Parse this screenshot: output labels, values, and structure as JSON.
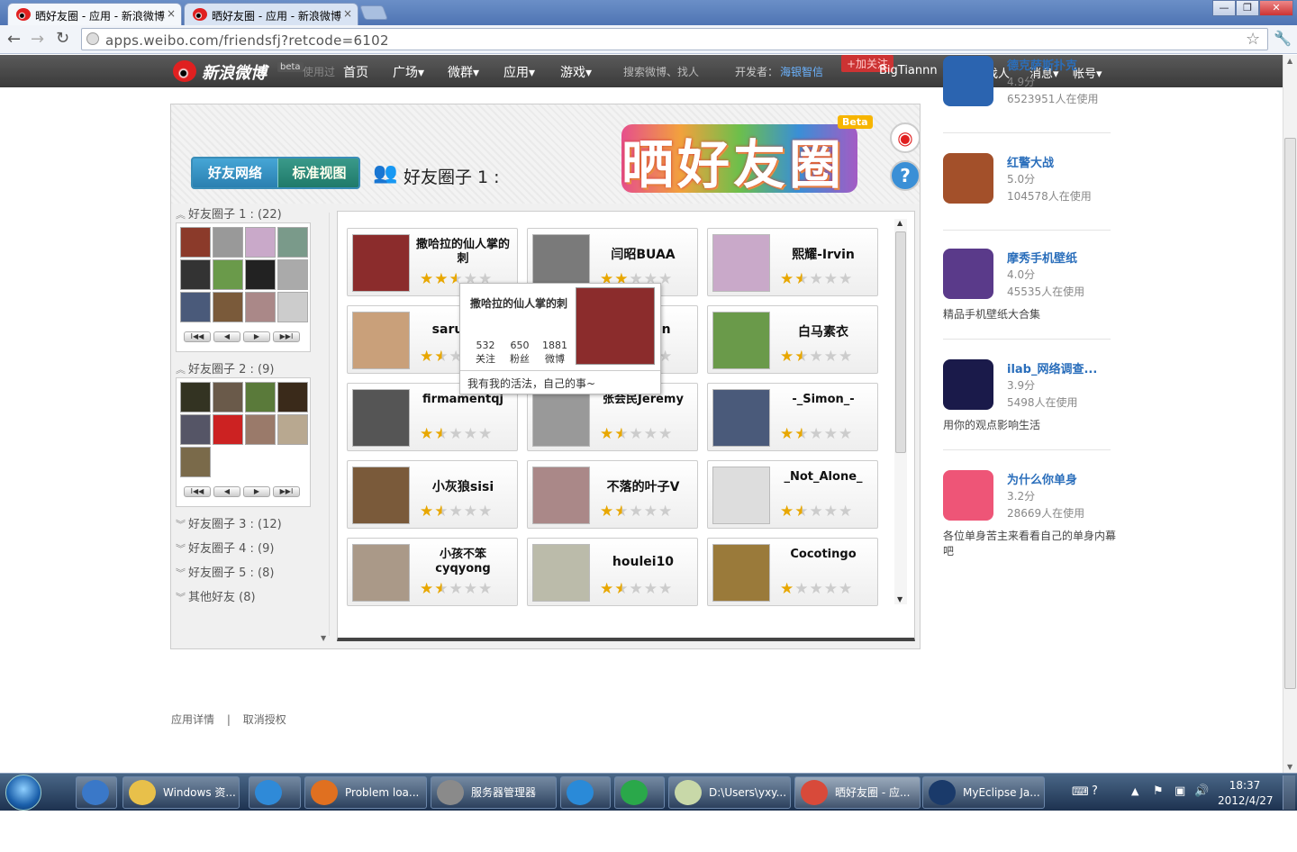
{
  "browser": {
    "tabs": [
      {
        "label": "晒好友圈 - 应用 - 新浪微博",
        "active": true
      },
      {
        "label": "晒好友圈 - 应用 - 新浪微博",
        "active": false
      }
    ],
    "close_symbol": "×",
    "url": "apps.weibo.com/friendsfj?retcode=6102",
    "window_controls": [
      "—",
      "❐",
      "✕"
    ]
  },
  "weibo_header": {
    "logo": "新浪微博",
    "beta": "beta",
    "hidden_text": "使用过",
    "nav": [
      "首页",
      "广场",
      "微群",
      "应用",
      "游戏"
    ],
    "search_placeholder": "搜索微博、找人",
    "developer_label": "开发者：",
    "developer_name": "海银智信",
    "follow_btn": "+加关注",
    "username": "BigTiannn",
    "right_nav": [
      "手机",
      "找人",
      "消息",
      "帐号"
    ]
  },
  "app": {
    "logo": "晒好友圈",
    "beta": "Beta",
    "help_icon": "?",
    "view_tabs": [
      "好友网络",
      "标准视图"
    ],
    "current_circle": "好友圈子 1 :",
    "groups": [
      {
        "label": "好友圈子 1 : (22)",
        "expanded": true
      },
      {
        "label": "好友圈子 2 : (9)",
        "expanded": true
      },
      {
        "label": "好友圈子 3 : (12)",
        "expanded": false
      },
      {
        "label": "好友圈子 4 : (9)",
        "expanded": false
      },
      {
        "label": "好友圈子 5 : (8)",
        "expanded": false
      },
      {
        "label": "其他好友 (8)",
        "expanded": false
      }
    ],
    "pager": [
      "I◀◀",
      "◀",
      "▶",
      "▶▶I"
    ],
    "friends": [
      {
        "name": "撒哈拉的仙人掌的刺",
        "rating": 2.5,
        "color": "#8b2c2c"
      },
      {
        "name": "闫昭BUAA",
        "rating": 2,
        "color": "#7a7a7a"
      },
      {
        "name": "熙耀-Irvin",
        "rating": 1.5,
        "color": "#c9a9c9"
      },
      {
        "name": "saruman",
        "rating": 1.5,
        "color": "#c9a07a"
      },
      {
        "name": "yayman",
        "rating": 1.5,
        "color": "#889"
      },
      {
        "name": "白马素衣",
        "rating": 1.5,
        "color": "#6a9a4a"
      },
      {
        "name": "firmamentqj",
        "rating": 1.5,
        "color": "#555"
      },
      {
        "name": "张会民Jeremy",
        "rating": 1.5,
        "color": "#999"
      },
      {
        "name": "-_Simon_-",
        "rating": 1.5,
        "color": "#4a5a7a"
      },
      {
        "name": "小灰狼sisi",
        "rating": 1.5,
        "color": "#7a5a3a"
      },
      {
        "name": "不落的叶子V",
        "rating": 1.5,
        "color": "#a88"
      },
      {
        "name": "_Not_Alone_",
        "rating": 1.5,
        "color": "#ddd"
      },
      {
        "name": "小孩不笨cyqyong",
        "rating": 1.5,
        "color": "#a98"
      },
      {
        "name": "houlei10",
        "rating": 1.5,
        "color": "#bba"
      },
      {
        "name": "Cocotingo",
        "rating": 1,
        "color": "#9a7a3a"
      }
    ],
    "tooltip": {
      "name": "撒哈拉的仙人掌的刺",
      "stats": [
        {
          "v": "532",
          "k": "关注"
        },
        {
          "v": "650",
          "k": "粉丝"
        },
        {
          "v": "1881",
          "k": "微博"
        }
      ],
      "bio": "我有我的活法，自己的事~"
    }
  },
  "sidebar_apps": [
    {
      "title": "德克萨斯扑克",
      "score": "4.9分",
      "users": "6523951人在使用",
      "desc": "",
      "color": "#2b64b0"
    },
    {
      "title": "红警大战",
      "score": "5.0分",
      "users": "104578人在使用",
      "desc": "",
      "color": "#a3502a"
    },
    {
      "title": "摩秀手机壁纸",
      "score": "4.0分",
      "users": "45535人在使用",
      "desc": "精品手机壁纸大合集",
      "color": "#5a3a8a"
    },
    {
      "title": "ilab_网络调查...",
      "score": "3.9分",
      "users": "5498人在使用",
      "desc": "用你的观点影响生活",
      "color": "#1a1a4a"
    },
    {
      "title": "为什么你单身",
      "score": "3.2分",
      "users": "28669人在使用",
      "desc": "各位单身苦主来看看自己的单身内幕吧",
      "color": "#ee5577"
    }
  ],
  "footer": {
    "links": [
      "应用详情",
      "取消授权"
    ],
    "sep": "|"
  },
  "taskbar": {
    "items": [
      "",
      "Windows 资...",
      "",
      "Problem loa...",
      "服务器管理器",
      "",
      "",
      "D:\\Users\\yxy...",
      "晒好友圈 - 应...",
      "MyEclipse Ja..."
    ],
    "time": "18:37",
    "date": "2012/4/27"
  }
}
